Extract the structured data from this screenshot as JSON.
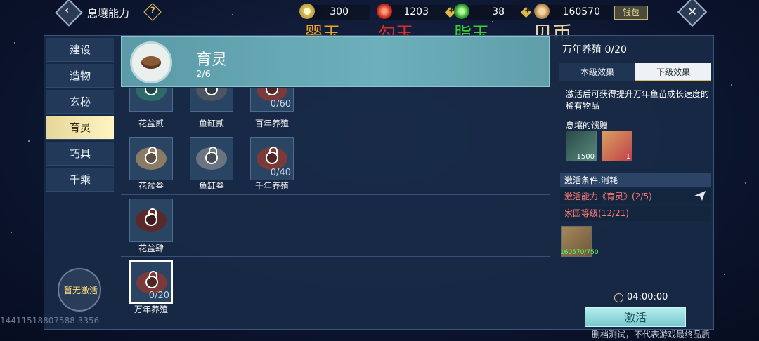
{
  "header": {
    "title": "息壤能力",
    "help_icon": "question-diamond-icon",
    "currencies": [
      {
        "value": "300",
        "icon": "jade-disc-icon",
        "label": "婴玉",
        "label_color": "#f0a31b"
      },
      {
        "value": "1203",
        "icon": "hook-jade-icon",
        "label": "勾玉",
        "label_color": "#e02a2a"
      },
      {
        "value": "38",
        "icon": "fat-jade-icon",
        "label": "脂玉",
        "label_color": "#3ccf2f"
      },
      {
        "value": "160570",
        "icon": "shell-coin-icon",
        "label": "贝币",
        "label_color": "#e6d2a0"
      }
    ],
    "wallet_label": "钱包"
  },
  "sidebar": {
    "items": [
      {
        "label": "建设"
      },
      {
        "label": "造物"
      },
      {
        "label": "玄秘"
      },
      {
        "label": "育灵"
      },
      {
        "label": "巧具"
      },
      {
        "label": "千乘"
      }
    ],
    "active_index": 3,
    "inactive_badge": "暂无激活"
  },
  "banner": {
    "title": "育灵",
    "progress": "2/6"
  },
  "grid": {
    "items": [
      {
        "label": "花盆贰",
        "count": ""
      },
      {
        "label": "鱼缸贰",
        "count": ""
      },
      {
        "label": "百年养殖",
        "count": "0/60"
      },
      {
        "label": "花盆叁",
        "count": ""
      },
      {
        "label": "鱼缸叁",
        "count": ""
      },
      {
        "label": "千年养殖",
        "count": "0/40"
      },
      {
        "label": "花盆肆",
        "count": ""
      },
      {
        "label": "万年养殖",
        "count": "0/20"
      }
    ]
  },
  "detail": {
    "title": "万年养殖 0/20",
    "tabs": [
      "本级效果",
      "下级效果"
    ],
    "active_tab": 1,
    "description": "激活后可获得提升万年鱼苗成长速度的稀有物品",
    "gift_label": "息壤的馈赠",
    "rewards": [
      {
        "count": "1500",
        "icon": "green-item-icon"
      },
      {
        "count": "1",
        "icon": "meat-item-icon"
      }
    ],
    "conditions_header": "激活条件.消耗",
    "conditions": [
      "激活能力《育灵》(2/5)",
      "家园等级(12/21)"
    ],
    "cost": {
      "count": "160570/750",
      "icon": "shell-coin-icon"
    },
    "timer": "04:00:00",
    "activate_label": "激活"
  },
  "footer": {
    "disclaimer": "删档测试，不代表游戏最终品质",
    "watermark": "14411518807588 3356"
  }
}
